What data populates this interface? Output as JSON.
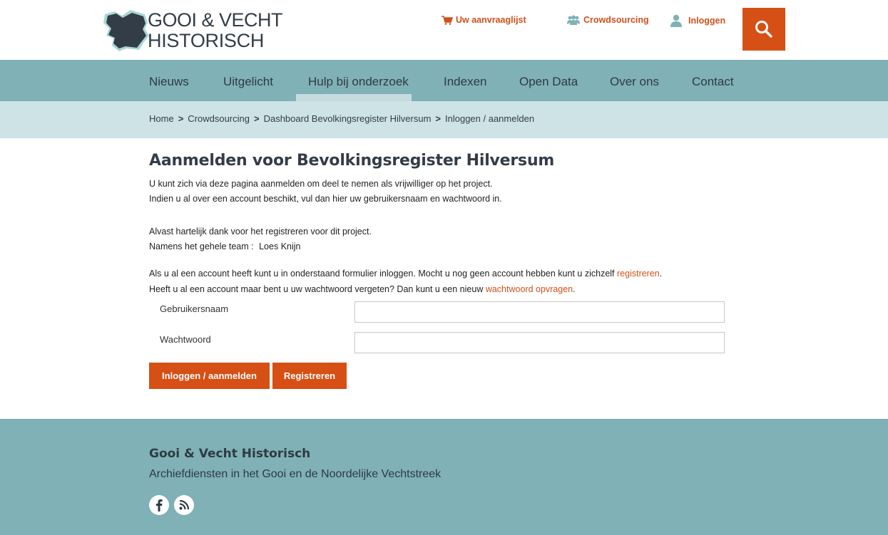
{
  "logo": {
    "line1": "GOOI & VECHT",
    "line2": "HISTORISCH"
  },
  "toplinks": {
    "cart": "Uw aanvraaglijst",
    "crowd": "Crowdsourcing",
    "login": "Inloggen"
  },
  "nav": [
    "Nieuws",
    "Uitgelicht",
    "Hulp bij onderzoek",
    "Indexen",
    "Open Data",
    "Over ons",
    "Contact"
  ],
  "nav_active": "Hulp bij onderzoek",
  "breadcrumb": [
    "Home",
    "Crowdsourcing",
    "Dashboard Bevolkingsregister Hilversum",
    "Inloggen / aanmelden"
  ],
  "breadcrumb_sep": ">",
  "main": {
    "title": "Aanmelden voor Bevolkingsregister Hilversum",
    "intro1": "U kunt zich via deze pagina aanmelden om deel te nemen als vrijwilliger op het project.",
    "intro2": "Indien u al over een account beschikt, vul dan hier uw gebruikersnaam en wachtwoord in.",
    "thanks": "Alvast hartelijk dank voor het registreren voor dit project.",
    "team_prefix": "Namens het gehele team :",
    "team_name": "Loes Knijn",
    "login_info_a": "Als u al een account heeft kunt u in onderstaand formulier inloggen. Mocht u nog geen account hebben kunt u zichzelf ",
    "login_info_link": "registreren",
    "login_info_b": ".",
    "forgot_a": "Heeft u al een account maar bent u uw wachtwoord vergeten? Dan kunt u een nieuw ",
    "forgot_link": "wachtwoord opvragen",
    "forgot_b": "."
  },
  "form": {
    "username_label": "Gebruikersnaam",
    "username_value": "",
    "password_label": "Wachtwoord",
    "password_value": ""
  },
  "buttons": {
    "login": "Inloggen / aanmelden",
    "register": "Registreren"
  },
  "footer": {
    "title": "Gooi & Vecht Historisch",
    "subtitle": "Archiefdiensten in het Gooi en de Noordelijke Vechtstreek"
  },
  "colors": {
    "accent": "#d64f15",
    "nav_bg": "#7fb1b6",
    "breadcrumb_bg": "#cde3e5",
    "text_dark": "#333d47"
  },
  "icons": [
    "cart-icon",
    "people-icon",
    "user-icon",
    "search-icon",
    "facebook-icon",
    "rss-icon"
  ]
}
